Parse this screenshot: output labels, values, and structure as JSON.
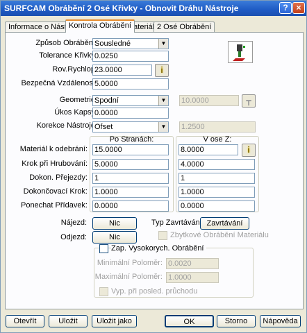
{
  "window": {
    "title": "SURFCAM Obrábění 2 Osé Křivky - Obnovit Dráhu Nástroje",
    "help_label": "?",
    "close_label": "×"
  },
  "tabs": [
    {
      "label": "Informace o Nástroji",
      "active": false
    },
    {
      "label": "Kontrola Obrábění",
      "active": true
    },
    {
      "label": "Materiál",
      "active": false
    },
    {
      "label": "2 Osé Obrábění",
      "active": false
    }
  ],
  "form": {
    "zpusob_label": "Způsob Obrábění:",
    "zpusob_value": "Sousledné",
    "tolerance_label": "Tolerance Křivky:",
    "tolerance_value": "0.0250",
    "rovrychlop_label": "Rov.Rychlop:",
    "rovrychlop_value": "23.0000",
    "bezpecna_label": "Bezpečná Vzdálenost:",
    "bezpecna_value": "5.0000",
    "geometrie_label": "Geometrie:",
    "geometrie_value": "Spodní",
    "geometrie_offset_value": "10.0000",
    "ukos_label": "Úkos Kapsy:",
    "ukos_value": "0.0000",
    "korekce_label": "Korekce Nástroje:",
    "korekce_value": "Ofset",
    "korekce_side_value": "1.2500",
    "info_icon_label": "i"
  },
  "grid": {
    "col1_header": "Po Stranách:",
    "col2_header": "V ose Z:",
    "rows": [
      {
        "label": "Materiál k odebrání:",
        "side": "15.0000",
        "z": "8.0000"
      },
      {
        "label": "Krok při Hrubování:",
        "side": "5.0000",
        "z": "4.0000"
      },
      {
        "label": "Dokon. Přejezdy:",
        "side": "1",
        "z": "1"
      },
      {
        "label": "Dokončovací Krok:",
        "side": "1.0000",
        "z": "1.0000"
      },
      {
        "label": "Ponechat Přídavek:",
        "side": "0.0000",
        "z": "0.0000"
      }
    ]
  },
  "links": {
    "najezd_label": "Nájezd:",
    "najezd_button": "Nic",
    "odjezd_label": "Odjezd:",
    "odjezd_button": "Nic",
    "typ_label": "Typ Zavrtávání:",
    "typ_button": "Zavrtávání",
    "zbytkove_label": "Zbytkové Obrábění Materiálu"
  },
  "highspeed": {
    "enable_label": "Zap. Vysokorych. Obrábění",
    "min_label": "Minimální Poloměr:",
    "min_value": "0.0020",
    "max_label": "Maximální Poloměr:",
    "max_value": "1.0000",
    "vyp_label": "Vyp. při posled. průchodu"
  },
  "buttons": {
    "open": "Otevřít",
    "save": "Uložit",
    "save_as": "Uložit jako",
    "ok": "OK",
    "cancel": "Storno",
    "help": "Nápověda"
  }
}
